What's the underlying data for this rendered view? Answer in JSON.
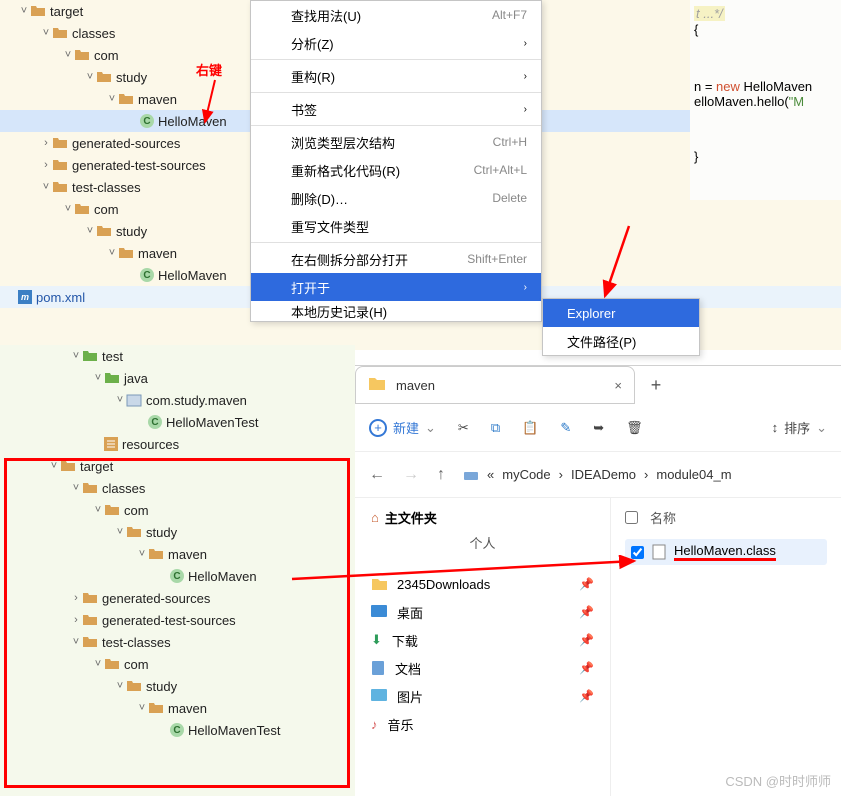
{
  "tree_top": {
    "target": "target",
    "classes": "classes",
    "com": "com",
    "study": "study",
    "maven": "maven",
    "hello": "HelloMaven",
    "gen_src": "generated-sources",
    "gen_tst": "generated-test-sources",
    "test_cls": "test-classes",
    "hello_test": "HelloMaven",
    "pom": "pom.xml"
  },
  "annot": {
    "right_click": "右键"
  },
  "ctx": {
    "usage": "查找用法(U)",
    "usage_key": "Alt+F7",
    "analyze": "分析(Z)",
    "refactor": "重构(R)",
    "bookmark": "书签",
    "hierarchy": "浏览类型层次结构",
    "hierarchy_key": "Ctrl+H",
    "reformat": "重新格式化代码(R)",
    "reformat_key": "Ctrl+Alt+L",
    "delete": "删除(D)…",
    "delete_key": "Delete",
    "override_ft": "重写文件类型",
    "split_right": "在右侧拆分部分打开",
    "split_key": "Shift+Enter",
    "open_in": "打开于",
    "local_hist": "本地历史记录(H)"
  },
  "submenu": {
    "explorer": "Explorer",
    "path": "文件路径(P)"
  },
  "code": {
    "l1": "t ...*/",
    "l2": "{",
    "l3a": "n = ",
    "l3b": "new",
    "l3c": " HelloMaven",
    "l4a": "elloMaven.hello(",
    "l4b": "\"M",
    "l5": "}"
  },
  "tree_btm": {
    "test": "test",
    "java": "java",
    "pkg": "com.study.maven",
    "hello_test": "HelloMavenTest",
    "resources": "resources",
    "target": "target",
    "classes": "classes",
    "com": "com",
    "study": "study",
    "maven": "maven",
    "hello": "HelloMaven",
    "gen_src": "generated-sources",
    "gen_tst": "generated-test-sources",
    "test_cls": "test-classes",
    "hello_test2": "HelloMavenTest"
  },
  "explorer": {
    "tab_title": "maven",
    "new": "新建",
    "sort": "排序",
    "crumb1": "myCode",
    "crumb2": "IDEADemo",
    "crumb3": "module04_m",
    "home": "主文件夹",
    "person": "个人",
    "items": [
      "2345Downloads",
      "桌面",
      "下载",
      "文档",
      "图片",
      "音乐"
    ],
    "col_name": "名称",
    "file": "HelloMaven.class"
  },
  "watermark": "CSDN @时时师师"
}
